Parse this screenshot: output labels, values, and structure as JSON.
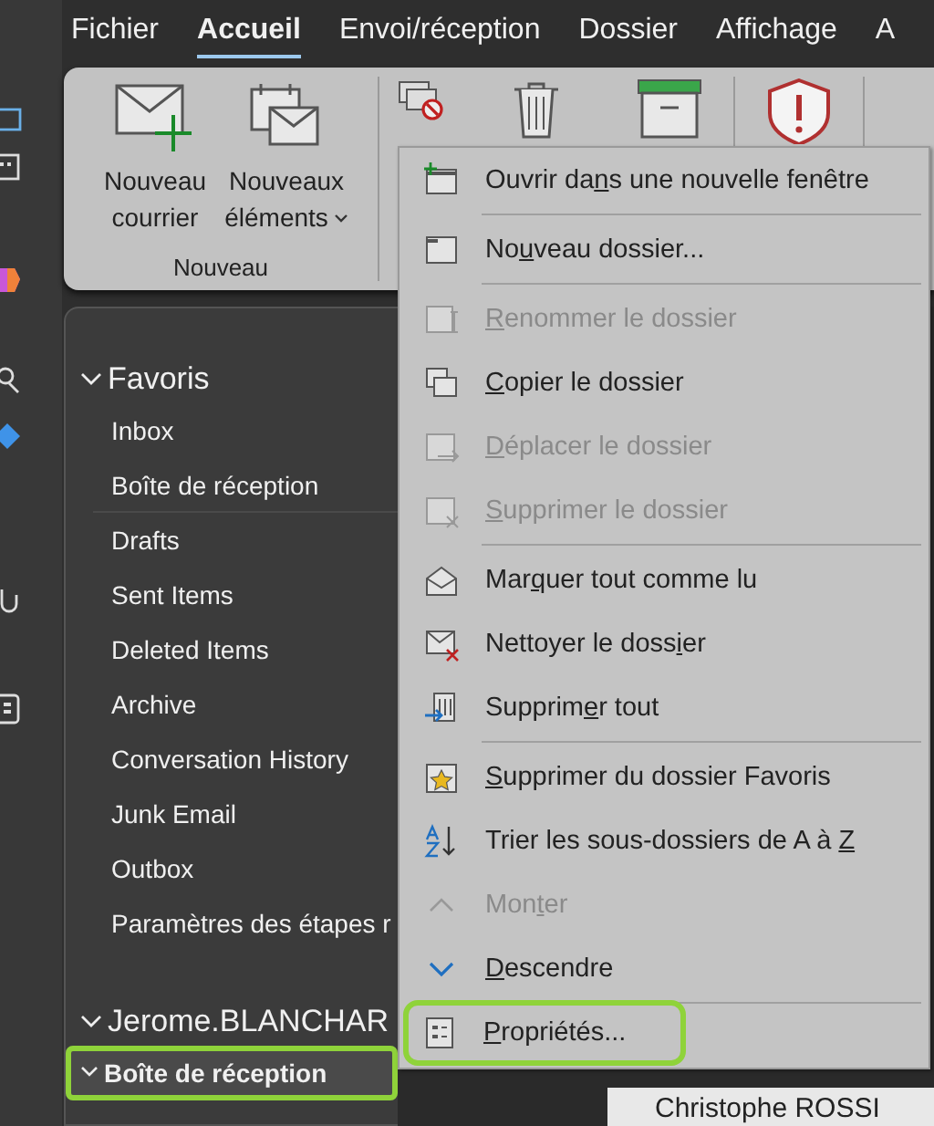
{
  "tabs": [
    {
      "label": "Fichier",
      "selected": false
    },
    {
      "label": "Accueil",
      "selected": true
    },
    {
      "label": "Envoi/réception",
      "selected": false
    },
    {
      "label": "Dossier",
      "selected": false
    },
    {
      "label": "Affichage",
      "selected": false
    },
    {
      "label": "A",
      "selected": false
    }
  ],
  "ribbon": {
    "new_group": {
      "label": "Nouveau",
      "buttons": [
        {
          "label": "Nouveau courrier",
          "kind": "mail"
        },
        {
          "label": "Nouveaux éléments",
          "kind": "items",
          "dropdown": true
        }
      ]
    },
    "tools": [
      {
        "kind": "ignore"
      },
      {
        "kind": "trash"
      },
      {
        "kind": "archive"
      },
      {
        "kind": "shield"
      }
    ]
  },
  "sidebar": {
    "sections": [
      {
        "label": "Favoris",
        "expanded": true,
        "items": [
          {
            "label": "Inbox",
            "selected": false
          },
          {
            "label": "Boîte de réception",
            "selected": false
          },
          {
            "label": "Drafts",
            "selected": false
          },
          {
            "label": "Sent Items",
            "selected": false
          },
          {
            "label": "Deleted Items",
            "selected": false
          },
          {
            "label": "Archive",
            "selected": false
          },
          {
            "label": "Conversation History",
            "selected": false
          },
          {
            "label": "Junk Email",
            "selected": false
          },
          {
            "label": "Outbox",
            "selected": false
          },
          {
            "label": "Paramètres des étapes r",
            "selected": false
          }
        ]
      },
      {
        "label": "Jerome.BLANCHAR",
        "expanded": true,
        "items": [
          {
            "label": "Boîte de réception",
            "selected": true,
            "highlighted": true,
            "expanded": true
          }
        ]
      }
    ]
  },
  "context_menu": [
    {
      "kind": "item",
      "before": "Ouvrir da",
      "key": "n",
      "after": "s une nouvelle fenêtre",
      "disabled": false,
      "highlighted": false
    },
    {
      "kind": "separator"
    },
    {
      "kind": "item",
      "before": "No",
      "key": "u",
      "after": "veau dossier...",
      "disabled": false,
      "highlighted": false
    },
    {
      "kind": "separator"
    },
    {
      "kind": "item",
      "key": "R",
      "after": "enommer le dossier",
      "disabled": true,
      "highlighted": false
    },
    {
      "kind": "item",
      "key": "C",
      "after": "opier le dossier",
      "disabled": false,
      "highlighted": false
    },
    {
      "kind": "item",
      "key": "D",
      "after": "éplacer le dossier",
      "disabled": true,
      "highlighted": false
    },
    {
      "kind": "item",
      "key": "S",
      "after": "upprimer le dossier",
      "disabled": true,
      "highlighted": false
    },
    {
      "kind": "separator"
    },
    {
      "kind": "item",
      "before": "Mar",
      "key": "q",
      "after": "uer tout comme lu",
      "disabled": false,
      "highlighted": false
    },
    {
      "kind": "item",
      "before": "Nettoyer le doss",
      "key": "i",
      "after": "er",
      "disabled": false,
      "highlighted": false
    },
    {
      "kind": "item",
      "before": "Supprim",
      "key": "e",
      "after": "r tout",
      "disabled": false,
      "highlighted": false
    },
    {
      "kind": "separator"
    },
    {
      "kind": "item",
      "key": "S",
      "after": "upprimer du dossier Favoris",
      "disabled": false,
      "highlighted": false
    },
    {
      "kind": "item",
      "before": "Trier les sous-dossiers de A à ",
      "key": "Z",
      "disabled": false,
      "highlighted": false
    },
    {
      "kind": "item",
      "before": "Mon",
      "key": "t",
      "after": "er",
      "disabled": true,
      "highlighted": false
    },
    {
      "kind": "item",
      "key": "D",
      "after": "escendre",
      "disabled": false,
      "highlighted": false
    },
    {
      "kind": "separator"
    },
    {
      "kind": "item",
      "key": "P",
      "after": "ropriétés...",
      "disabled": false,
      "highlighted": true
    }
  ],
  "reading_pane": {
    "sender": "Christophe ROSSI"
  }
}
